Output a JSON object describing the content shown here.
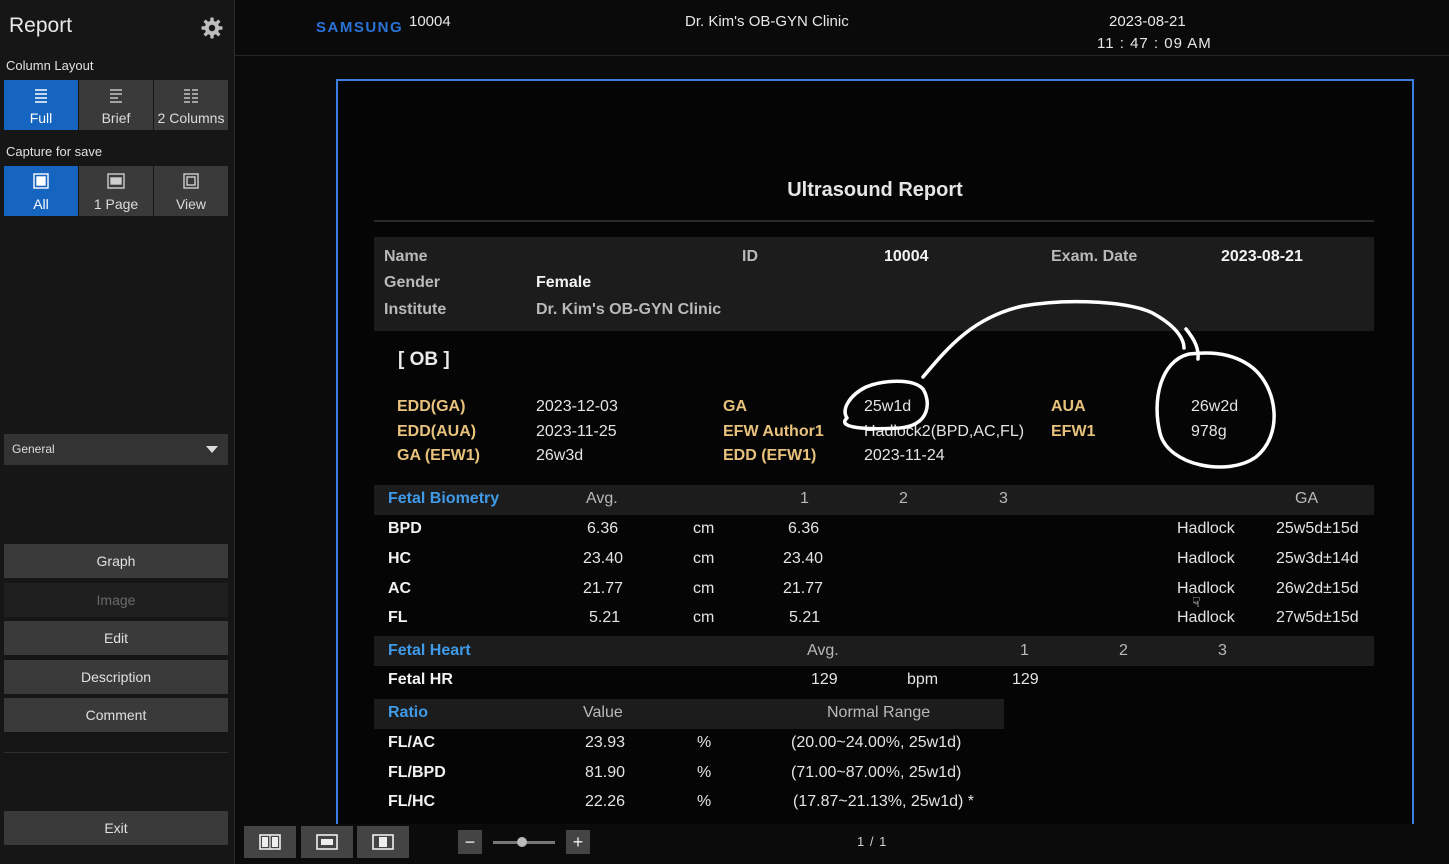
{
  "sidebar": {
    "title": "Report",
    "column_layout": {
      "label": "Column Layout",
      "options": [
        {
          "label": "Full",
          "icon": "full-layout-icon",
          "active": true
        },
        {
          "label": "Brief",
          "icon": "brief-layout-icon",
          "active": false
        },
        {
          "label": "2 Columns",
          "icon": "two-columns-icon",
          "active": false
        }
      ]
    },
    "capture": {
      "label": "Capture for save",
      "options": [
        {
          "label": "All",
          "icon": "capture-all-icon",
          "active": true
        },
        {
          "label": "1 Page",
          "icon": "capture-page-icon",
          "active": false
        },
        {
          "label": "View",
          "icon": "capture-view-icon",
          "active": false
        }
      ]
    },
    "dropdown": {
      "selected": "General"
    },
    "buttons": {
      "graph": "Graph",
      "image": "Image",
      "edit": "Edit",
      "description": "Description",
      "comment": "Comment",
      "exit": "Exit"
    }
  },
  "header": {
    "brand": "SAMSUNG",
    "patient_id": "10004",
    "clinic": "Dr. Kim's OB-GYN Clinic",
    "date": "2023-08-21",
    "time": "11 : 47 : 09 AM"
  },
  "report": {
    "title": "Ultrasound Report",
    "patient": {
      "name_label": "Name",
      "id_label": "ID",
      "id_value": "10004",
      "exam_date_label": "Exam. Date",
      "exam_date_value": "2023-08-21",
      "gender_label": "Gender",
      "gender_value": "Female",
      "institute_label": "Institute",
      "institute_value": "Dr. Kim's OB-GYN Clinic"
    },
    "ob": {
      "section_label": "[ OB ]",
      "edd_ga_label": "EDD(GA)",
      "edd_ga_value": "2023-12-03",
      "edd_aua_label": "EDD(AUA)",
      "edd_aua_value": "2023-11-25",
      "ga_efw1_label": "GA (EFW1)",
      "ga_efw1_value": "26w3d",
      "ga_label": "GA",
      "ga_value": "25w1d",
      "efw_author_label": "EFW Author1",
      "efw_author_value": "Hadlock2(BPD,AC,FL)",
      "edd_efw1_label": "EDD (EFW1)",
      "edd_efw1_value": "2023-11-24",
      "aua_label": "AUA",
      "aua_value": "26w2d",
      "efw1_label": "EFW1",
      "efw1_value": "978g"
    },
    "biometry": {
      "header": {
        "title": "Fetal Biometry",
        "avg": "Avg.",
        "c1": "1",
        "c2": "2",
        "c3": "3",
        "ga": "GA"
      },
      "rows": [
        {
          "name": "BPD",
          "avg": "6.36",
          "unit": "cm",
          "m1": "6.36",
          "author": "Hadlock",
          "ga": "25w5d±15d"
        },
        {
          "name": "HC",
          "avg": "23.40",
          "unit": "cm",
          "m1": "23.40",
          "author": "Hadlock",
          "ga": "25w3d±14d"
        },
        {
          "name": "AC",
          "avg": "21.77",
          "unit": "cm",
          "m1": "21.77",
          "author": "Hadlock",
          "ga": "26w2d±15d"
        },
        {
          "name": "FL",
          "avg": "5.21",
          "unit": "cm",
          "m1": "5.21",
          "author": "Hadlock",
          "ga": "27w5d±15d"
        }
      ]
    },
    "heart": {
      "header": {
        "title": "Fetal Heart",
        "avg": "Avg.",
        "c1": "1",
        "c2": "2",
        "c3": "3"
      },
      "row": {
        "name": "Fetal HR",
        "avg": "129",
        "unit": "bpm",
        "m1": "129"
      }
    },
    "ratio": {
      "header": {
        "title": "Ratio",
        "value": "Value",
        "range": "Normal Range"
      },
      "rows": [
        {
          "name": "FL/AC",
          "value": "23.93",
          "unit": "%",
          "range": "(20.00~24.00%, 25w1d)"
        },
        {
          "name": "FL/BPD",
          "value": "81.90",
          "unit": "%",
          "range": "(71.00~87.00%, 25w1d)"
        },
        {
          "name": "FL/HC",
          "value": "22.26",
          "unit": "%",
          "range": "(17.87~21.13%, 25w1d) *"
        }
      ]
    }
  },
  "bottom": {
    "zoom_out": "−",
    "zoom_in": "+",
    "page": "1 / 1"
  }
}
